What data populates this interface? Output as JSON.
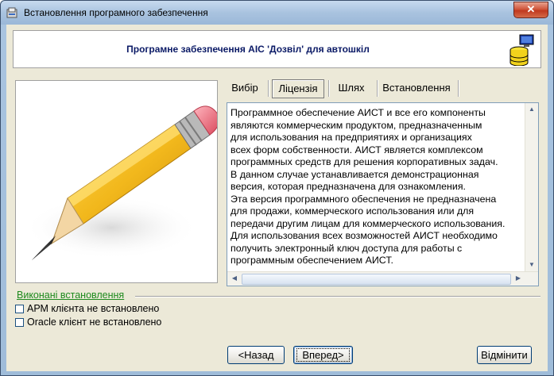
{
  "window": {
    "title": "Встановлення програмного забезпечення",
    "close_label": "✕"
  },
  "header": {
    "title": "Програмне забезпечення АІС 'Дозвіл' для автошкіл"
  },
  "tabs": [
    {
      "label": "Вибір",
      "active": false
    },
    {
      "label": "Ліцензія",
      "active": true
    },
    {
      "label": "Шлях",
      "active": false
    },
    {
      "label": "Встановлення",
      "active": false
    }
  ],
  "license": {
    "text": "Программное обеспечение АИСТ и все его компоненты\nявляются коммерческим продуктом, предназначенным\nдля использования на предприятиях и организациях\nвсех форм собственности. АИСТ является комплексом\nпрограммных средств для решения корпоративных задач.\nВ данном случае устанавливается демонстрационная\nверсия, которая предназначена для ознакомления.\nЭта версия программного обеспечения не предназначена\nдля продажи, коммерческого использования или для\nпередачи другим лицам для коммерческого использования.\nДля использования всех возможностей АИСТ необходимо\nполучить электронный ключ доступа для работы с\nпрограммным обеспечением АИСТ."
  },
  "completed": {
    "label": "Виконані встановлення",
    "items": [
      {
        "label": "АРМ клієнта не встановлено",
        "checked": false
      },
      {
        "label": "Oracle клієнт не встановлено",
        "checked": false
      }
    ]
  },
  "buttons": {
    "back": "<Назад",
    "next": "Вперед>",
    "cancel": "Відмінити"
  },
  "colors": {
    "title_text": "#0b1a66",
    "group_label": "#1e8a1e",
    "pencil_body": "#f2b81c",
    "eraser": "#e86a78"
  }
}
